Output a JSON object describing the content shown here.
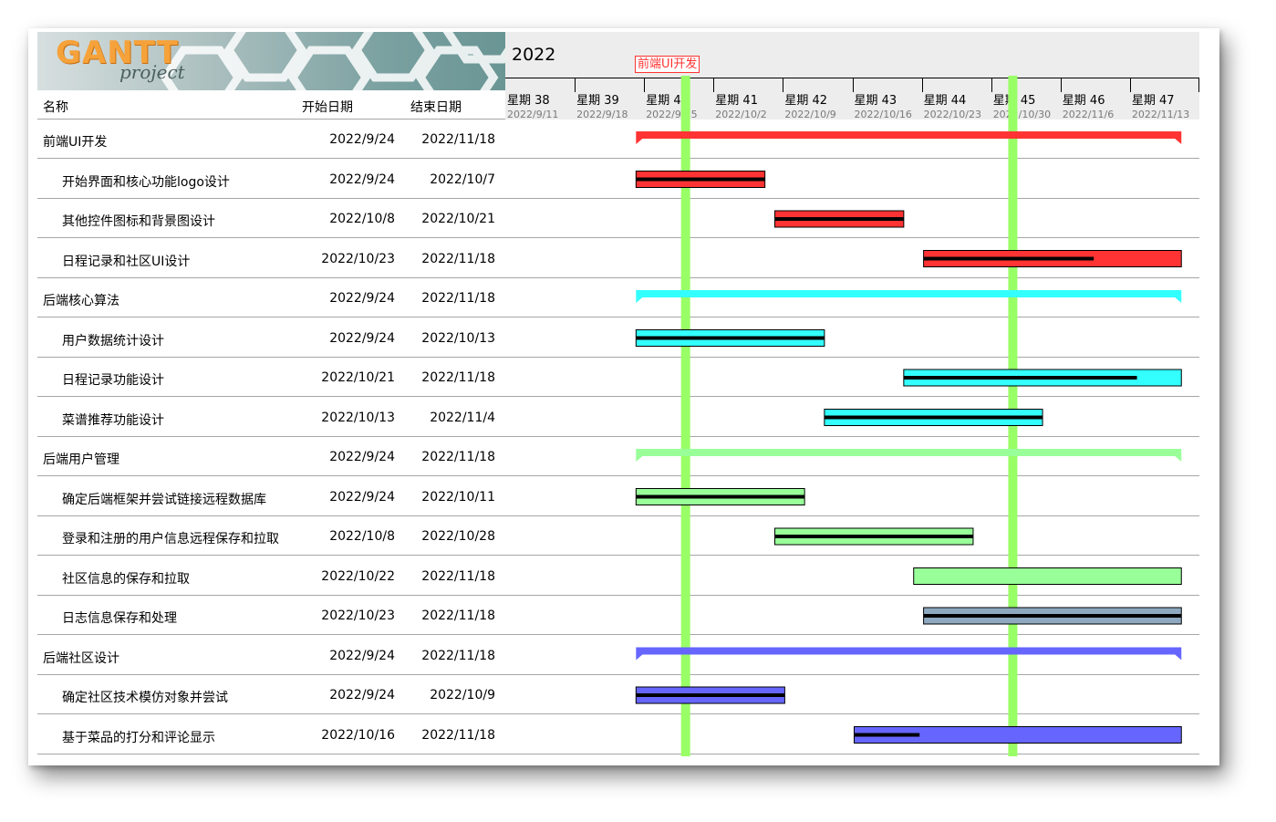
{
  "app": {
    "logo_text": "GANTT",
    "logo_subtext": "project"
  },
  "table": {
    "headers": {
      "name": "名称",
      "start": "开始日期",
      "end": "结束日期"
    },
    "rows": [
      {
        "name": "前端UI开发",
        "start": "2022/9/24",
        "end": "2022/11/18",
        "level": 0
      },
      {
        "name": "开始界面和核心功能logo设计",
        "start": "2022/9/24",
        "end": "2022/10/7",
        "level": 1
      },
      {
        "name": "其他控件图标和背景图设计",
        "start": "2022/10/8",
        "end": "2022/10/21",
        "level": 1
      },
      {
        "name": "日程记录和社区UI设计",
        "start": "2022/10/23",
        "end": "2022/11/18",
        "level": 1
      },
      {
        "name": "后端核心算法",
        "start": "2022/9/24",
        "end": "2022/11/18",
        "level": 0
      },
      {
        "name": "用户数据统计设计",
        "start": "2022/9/24",
        "end": "2022/10/13",
        "level": 1
      },
      {
        "name": "日程记录功能设计",
        "start": "2022/10/21",
        "end": "2022/11/18",
        "level": 1
      },
      {
        "name": "菜谱推荐功能设计",
        "start": "2022/10/13",
        "end": "2022/11/4",
        "level": 1
      },
      {
        "name": "后端用户管理",
        "start": "2022/9/24",
        "end": "2022/11/18",
        "level": 0
      },
      {
        "name": "确定后端框架并尝试链接远程数据库",
        "start": "2022/9/24",
        "end": "2022/10/11",
        "level": 1
      },
      {
        "name": "登录和注册的用户信息远程保存和拉取",
        "start": "2022/10/8",
        "end": "2022/10/28",
        "level": 1
      },
      {
        "name": "社区信息的保存和拉取",
        "start": "2022/10/22",
        "end": "2022/11/18",
        "level": 1
      },
      {
        "name": "日志信息保存和处理",
        "start": "2022/10/23",
        "end": "2022/11/18",
        "level": 1
      },
      {
        "name": "后端社区设计",
        "start": "2022/9/24",
        "end": "2022/11/18",
        "level": 0
      },
      {
        "name": "确定社区技术模仿对象并尝试",
        "start": "2022/9/24",
        "end": "2022/10/9",
        "level": 1
      },
      {
        "name": "基于菜品的打分和评论显示",
        "start": "2022/10/16",
        "end": "2022/11/18",
        "level": 1
      }
    ]
  },
  "timeline": {
    "year": "2022",
    "milestone_label": "前端UI开发",
    "weeks": [
      {
        "label": "星期 38",
        "date": "2022/9/11"
      },
      {
        "label": "星期 39",
        "date": "2022/9/18"
      },
      {
        "label": "星期 40",
        "date": "2022/9/25"
      },
      {
        "label": "星期 41",
        "date": "2022/10/2"
      },
      {
        "label": "星期 42",
        "date": "2022/10/9"
      },
      {
        "label": "星期 43",
        "date": "2022/10/16"
      },
      {
        "label": "星期 44",
        "date": "2022/10/23"
      },
      {
        "label": "星期 45",
        "date": "2022/10/30"
      },
      {
        "label": "星期 46",
        "date": "2022/11/6"
      },
      {
        "label": "星期 47",
        "date": "2022/11/13"
      }
    ]
  },
  "chart_data": {
    "type": "gantt",
    "axis_start": "2022-09-11",
    "axis_end": "2022-11-20",
    "today_markers": [
      "2022-09-29",
      "2022-11-01"
    ],
    "colors": {
      "group0": "#ff3333",
      "group1": "#33ffff",
      "group2": "#99ff99",
      "group3": "#6666ff",
      "task_alt": "#8ea9bf",
      "marker": "#99ff66",
      "outline": "#000000"
    },
    "bars": [
      {
        "group": true,
        "color": "#ff3333",
        "start": "2022-09-24",
        "end": "2022-11-18"
      },
      {
        "group": false,
        "color": "#ff3333",
        "start": "2022-09-24",
        "end": "2022-10-07",
        "progress": 1.0
      },
      {
        "group": false,
        "color": "#ff3333",
        "start": "2022-10-08",
        "end": "2022-10-21",
        "progress": 1.0
      },
      {
        "group": false,
        "color": "#ff3333",
        "start": "2022-10-23",
        "end": "2022-11-18",
        "progress": 0.66
      },
      {
        "group": true,
        "color": "#33ffff",
        "start": "2022-09-24",
        "end": "2022-11-18"
      },
      {
        "group": false,
        "color": "#33ffff",
        "start": "2022-09-24",
        "end": "2022-10-13",
        "progress": 1.0
      },
      {
        "group": false,
        "color": "#33ffff",
        "start": "2022-10-21",
        "end": "2022-11-18",
        "progress": 0.84
      },
      {
        "group": false,
        "color": "#33ffff",
        "start": "2022-10-13",
        "end": "2022-11-04",
        "progress": 1.0
      },
      {
        "group": true,
        "color": "#99ff99",
        "start": "2022-09-24",
        "end": "2022-11-18"
      },
      {
        "group": false,
        "color": "#99ff99",
        "start": "2022-09-24",
        "end": "2022-10-11",
        "progress": 1.0
      },
      {
        "group": false,
        "color": "#99ff99",
        "start": "2022-10-08",
        "end": "2022-10-28",
        "progress": 1.0
      },
      {
        "group": false,
        "color": "#99ff99",
        "start": "2022-10-22",
        "end": "2022-11-18",
        "progress": 0.0
      },
      {
        "group": false,
        "color": "#8ea9bf",
        "start": "2022-10-23",
        "end": "2022-11-18",
        "progress": 1.0
      },
      {
        "group": true,
        "color": "#6666ff",
        "start": "2022-09-24",
        "end": "2022-11-18"
      },
      {
        "group": false,
        "color": "#6666ff",
        "start": "2022-09-24",
        "end": "2022-10-09",
        "progress": 1.0
      },
      {
        "group": false,
        "color": "#6666ff",
        "start": "2022-10-16",
        "end": "2022-11-18",
        "progress": 0.2
      }
    ]
  }
}
